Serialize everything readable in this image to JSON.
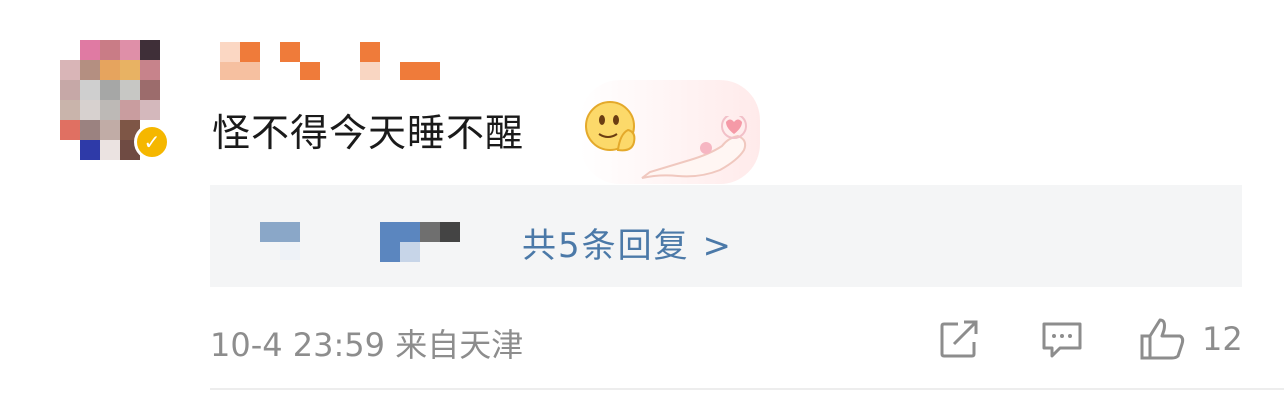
{
  "comment": {
    "text": "怪不得今天睡不醒",
    "emoji": "thinking-face-emoji"
  },
  "replies": {
    "link_text": "共5条回复 >"
  },
  "meta": {
    "timestamp": "10-4 23:59",
    "location": "来自天津"
  },
  "actions": {
    "like_count": "12"
  },
  "colors": {
    "reply_link": "#4b79a8",
    "meta_text": "#8d8d8d",
    "replies_bg": "#f4f5f6",
    "verified_badge": "#f5b700"
  }
}
